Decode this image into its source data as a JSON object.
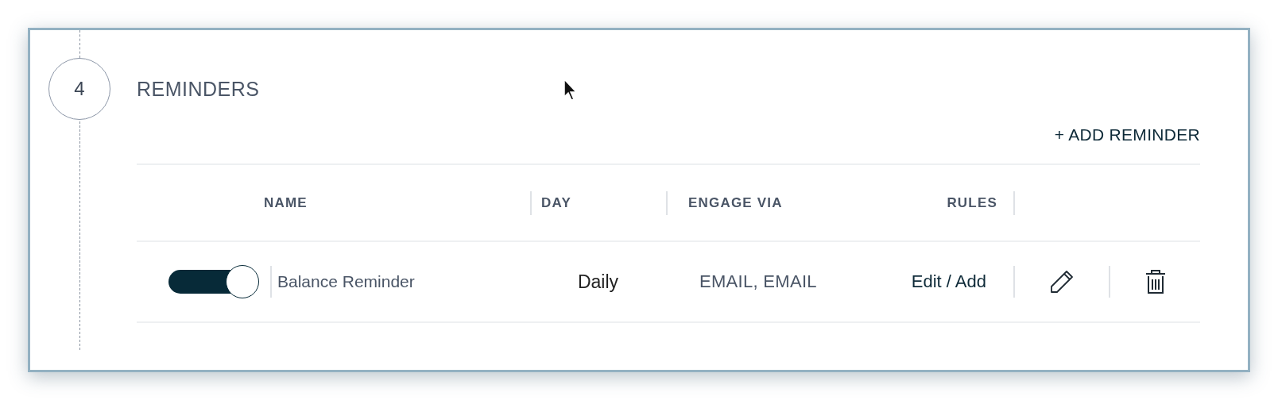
{
  "step": {
    "number": "4",
    "title": "REMINDERS"
  },
  "add_button": "+ ADD REMINDER",
  "table": {
    "columns": [
      "NAME",
      "DAY",
      "ENGAGE VIA",
      "RULES"
    ],
    "rows": [
      {
        "enabled": true,
        "name": "Balance Reminder",
        "day": "Daily",
        "engage_via": "EMAIL, EMAIL",
        "rules": "Edit / Add"
      }
    ]
  }
}
